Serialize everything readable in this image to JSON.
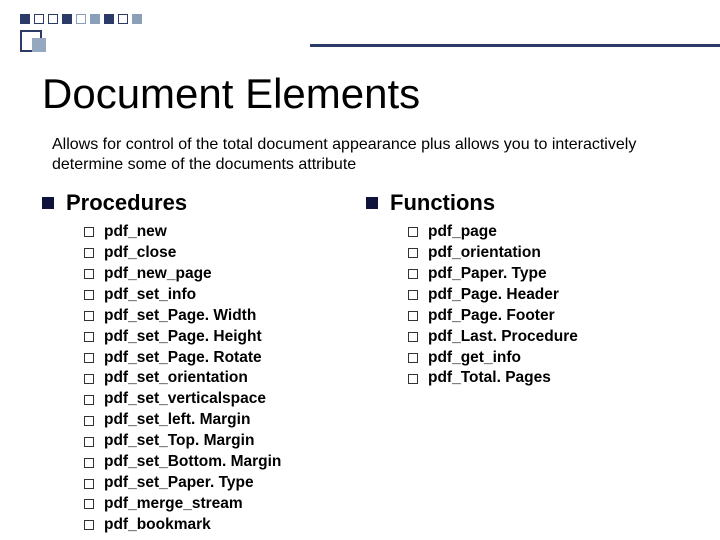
{
  "title": "Document Elements",
  "subtitle": "Allows for control of the total document appearance plus allows you to interactively determine some of the documents attribute",
  "sections": {
    "left": {
      "heading": "Procedures",
      "items": [
        "pdf_new",
        "pdf_close",
        "pdf_new_page",
        "pdf_set_info",
        "pdf_set_Page. Width",
        "pdf_set_Page. Height",
        "pdf_set_Page. Rotate",
        "pdf_set_orientation",
        "pdf_set_verticalspace",
        "pdf_set_left. Margin",
        "pdf_set_Top. Margin",
        "pdf_set_Bottom. Margin",
        "pdf_set_Paper. Type",
        "pdf_merge_stream",
        "pdf_bookmark"
      ]
    },
    "right": {
      "heading": "Functions",
      "items": [
        "pdf_page",
        "pdf_orientation",
        "pdf_Paper. Type",
        "pdf_Page. Header",
        "pdf_Page. Footer",
        "pdf_Last. Procedure",
        "pdf_get_info",
        "pdf_Total. Pages"
      ]
    }
  }
}
